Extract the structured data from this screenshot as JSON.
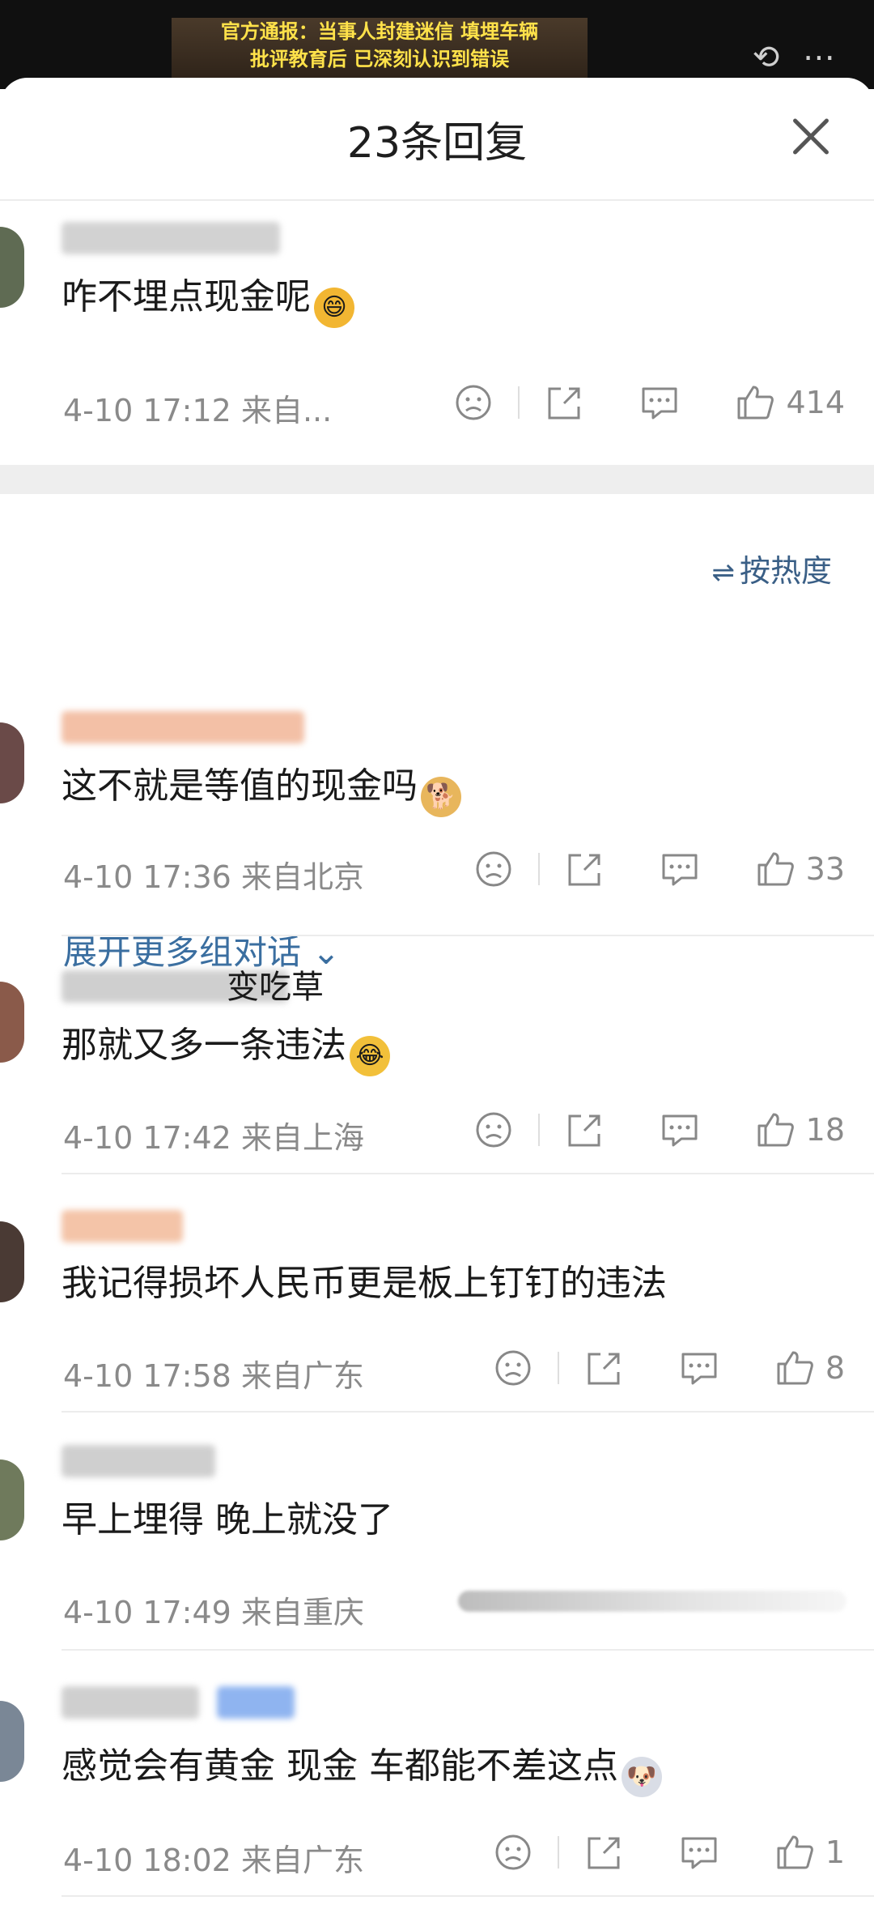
{
  "video": {
    "banner_line1": "官方通报：当事人封建迷信 填埋车辆",
    "banner_line2": "批评教育后 已深刻认识到错误"
  },
  "sheet": {
    "title": "23条回复"
  },
  "root_comment": {
    "text": "咋不埋点现金呢",
    "emoji": "grin-emoji",
    "time": "4-10 17:12",
    "source": "来自...",
    "likes": "414"
  },
  "sort": {
    "label": "按热度",
    "icon": "sort-icon"
  },
  "comments": [
    {
      "text": "这不就是等值的现金吗",
      "emoji": "doge-emoji",
      "time": "4-10 17:36",
      "source": "来自北京",
      "likes": "33",
      "expand": "展开更多组对话",
      "name_suffix": ""
    },
    {
      "text": "那就又多一条违法",
      "emoji": "cry-laugh-emoji",
      "time": "4-10 17:42",
      "source": "来自上海",
      "likes": "18",
      "name_suffix": "变吃草"
    },
    {
      "text": "我记得损坏人民币更是板上钉钉的违法",
      "time": "4-10 17:58",
      "source": "来自广东",
      "likes": "8"
    },
    {
      "text": "早上埋得 晚上就没了",
      "time": "4-10 17:49",
      "source": "来自重庆",
      "likes": ""
    },
    {
      "text": "感觉会有黄金 现金 车都能不差这点",
      "emoji": "husky-emoji",
      "time": "4-10 18:02",
      "source": "来自广东",
      "likes": "1"
    }
  ],
  "colors": {
    "link": "#3a6ea0",
    "meta": "#8a8a8a",
    "band": "#eeeeee"
  }
}
